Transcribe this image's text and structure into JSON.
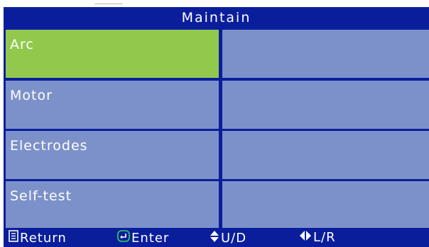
{
  "header": {
    "title": "Maintain"
  },
  "menu": {
    "items": [
      {
        "label": "Arc",
        "selected": true
      },
      {
        "label": "Motor"
      },
      {
        "label": "Electrodes"
      },
      {
        "label": "Self-test"
      }
    ]
  },
  "footer": {
    "return_label": "Return",
    "enter_label": "Enter",
    "ud_label": "U/D",
    "lr_label": "L/R",
    "icons": [
      "return-icon",
      "enter-icon",
      "up-down-icon",
      "left-right-icon"
    ]
  },
  "colors": {
    "screen_bg": "#0a1e9c",
    "cell": "#7c91c9",
    "cell_selected": "#92c94c",
    "enter_icon": "#2fd45a"
  }
}
